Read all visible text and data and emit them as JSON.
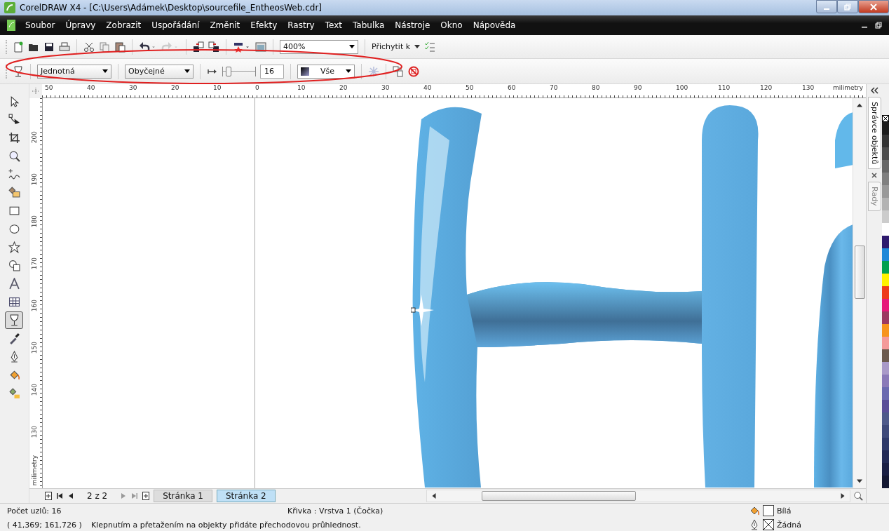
{
  "window": {
    "title": "CorelDRAW X4 - [C:\\Users\\Adámek\\Desktop\\sourcefile_EntheosWeb.cdr]"
  },
  "menu": [
    "Soubor",
    "Úpravy",
    "Zobrazit",
    "Uspořádání",
    "Změnit",
    "Efekty",
    "Rastry",
    "Text",
    "Tabulka",
    "Nástroje",
    "Okno",
    "Nápověda"
  ],
  "standard_toolbar": {
    "zoom": "400%",
    "snap": "Přichytit k"
  },
  "property_bar": {
    "transparency_type": "Jednotná",
    "merge_mode": "Obyčejné",
    "transparency": {
      "level": 0.16,
      "value": "16"
    },
    "apply_to": "Vše"
  },
  "toolbox": [
    {
      "selected": false
    },
    {
      "selected": false
    },
    {
      "selected": false
    },
    {
      "selected": false
    },
    {
      "selected": false
    },
    {
      "selected": false
    },
    {
      "selected": false
    },
    {
      "selected": false
    },
    {
      "selected": false
    },
    {
      "selected": false
    },
    {
      "selected": false
    },
    {
      "selected": false
    },
    {
      "selected": true
    },
    {
      "selected": false
    },
    {
      "selected": false
    },
    {
      "selected": false
    },
    {
      "selected": false
    }
  ],
  "rulers": {
    "horizontal": [
      "50",
      "40",
      "30",
      "20",
      "10",
      "0",
      "10",
      "20",
      "30",
      "40",
      "50",
      "60",
      "70",
      "80",
      "90",
      "100",
      "110",
      "120",
      "130"
    ],
    "horizontal_unit": "milimetry",
    "vertical": [
      "200",
      "190",
      "180",
      "170",
      "160",
      "150",
      "140",
      "130"
    ],
    "vertical_unit": "milimetry"
  },
  "page_nav": {
    "counter": "2 z 2",
    "tabs": [
      {
        "label": "Stránka 1",
        "selected": false
      },
      {
        "label": "Stránka 2",
        "selected": true
      }
    ]
  },
  "dockers": [
    {
      "label": "Správce objektů",
      "selected": true
    },
    {
      "label": "Rady",
      "selected": false
    }
  ],
  "palette": [
    {
      "color": "#1a1a1a"
    },
    {
      "color": "#333333"
    },
    {
      "color": "#4d4d4d"
    },
    {
      "color": "#666666"
    },
    {
      "color": "#808080"
    },
    {
      "color": "#999999"
    },
    {
      "color": "#b3b3b3"
    },
    {
      "color": "#cccccc"
    },
    {
      "color": "#ffffff"
    },
    {
      "color": "#2e1a6e"
    },
    {
      "color": "#1e88d8"
    },
    {
      "color": "#00a050"
    },
    {
      "color": "#fff200"
    },
    {
      "color": "#ee3a1b"
    },
    {
      "color": "#e6197a"
    },
    {
      "color": "#9b3a62"
    },
    {
      "color": "#f7941d"
    },
    {
      "color": "#f49a9a"
    },
    {
      "color": "#6b5a4e"
    },
    {
      "color": "#a99ac8"
    },
    {
      "color": "#8a7ab8"
    },
    {
      "color": "#6a6ab0"
    },
    {
      "color": "#5a4e98"
    },
    {
      "color": "#4e5a8a"
    },
    {
      "color": "#3e4a7a"
    },
    {
      "color": "#2e3a6a"
    },
    {
      "color": "#222a55"
    },
    {
      "color": "#1a1f44"
    },
    {
      "color": "#141833"
    }
  ],
  "status_bar": {
    "nodes": "Počet uzlů: 16",
    "object": "Křivka : Vrstva 1  (Čočka)",
    "coordinates": "( 41,369; 161,726 )",
    "hint": "Klepnutím a přetažením na objekty přidáte přechodovou průhlednost.",
    "fill": "Bílá",
    "outline": "Žádná"
  }
}
